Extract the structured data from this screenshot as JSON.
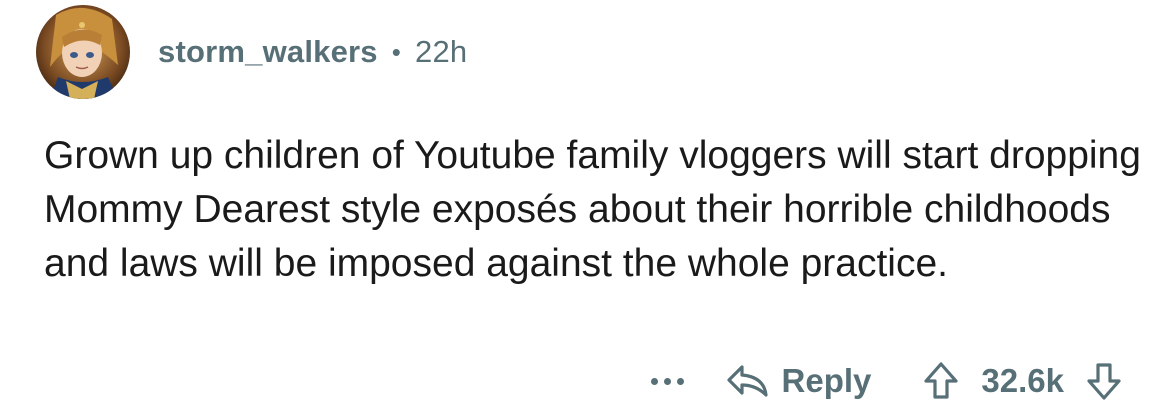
{
  "comment": {
    "username": "storm_walkers",
    "separator": "•",
    "time": "22h",
    "body": "Grown up children of Youtube family vloggers will start dropping Mommy Dearest style exposés about their horrible childhoods and laws will be imposed against the whole practice.",
    "avatar_icon": "avatar-image"
  },
  "actions": {
    "more_icon": "more-dots-icon",
    "reply_label": "Reply",
    "reply_icon": "reply-arrow-icon",
    "upvote_icon": "upvote-arrow-icon",
    "score": "32.6k",
    "downvote_icon": "downvote-arrow-icon"
  },
  "colors": {
    "text": "#1a1a1b",
    "meta": "#576f76"
  }
}
